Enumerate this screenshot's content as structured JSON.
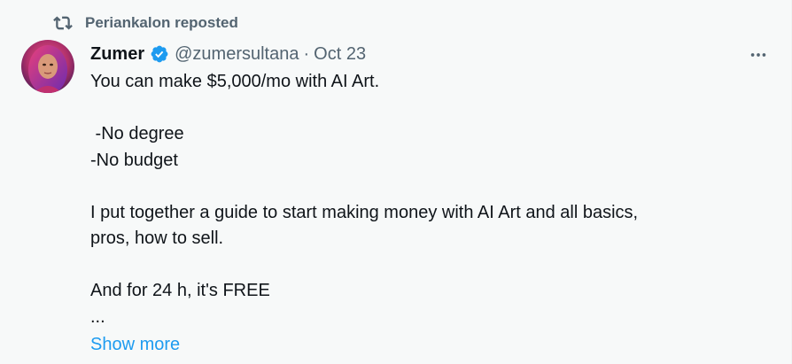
{
  "repost": {
    "icon": "repost-icon",
    "text": "Periankalon reposted"
  },
  "author": {
    "name": "Zumer",
    "handle": "@zumersultana",
    "separator": "·",
    "date": "Oct 23",
    "verified_icon": "verified-badge-icon",
    "avatar": "avatar"
  },
  "more_icon": "more-options-icon",
  "body": {
    "line1": "You can make $5,000/mo with AI Art.",
    "line2": " -No degree",
    "line3": "-No budget",
    "line4": "I put together a guide to start making money with AI Art and all basics,",
    "line5": "pros, how to sell.",
    "line6": "And for 24 h, it's FREE",
    "line7": "..."
  },
  "show_more": "Show more",
  "colors": {
    "secondary_text": "#536471",
    "accent": "#1d9bf0",
    "background": "#f7f9f9"
  }
}
